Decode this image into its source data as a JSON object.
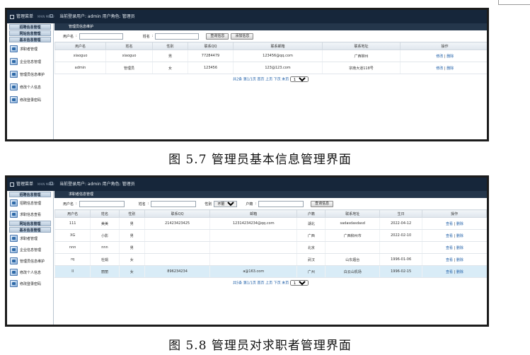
{
  "app": {
    "menu_title": "管理菜单",
    "menu_sub": "MAIN MENU",
    "user_info": "当前登录用户: admin 用户角色: 管理员"
  },
  "figure1": {
    "caption": "图 5.7 管理员基本信息管理界面",
    "sidebar": {
      "heads": [
        "招聘信息管理",
        "网站信息管理",
        "基本信息管理"
      ],
      "items": [
        "求职者管理",
        "企业信息管理",
        "管理员信息维护",
        "修改个人信息",
        "修改登录密码"
      ]
    },
    "panel_title": "管理员信息维护",
    "search": {
      "username_label": "用户名",
      "name_label": "姓名",
      "query_button": "查询信息",
      "add_button": "添加信息"
    },
    "table": {
      "headers": [
        "用户名",
        "姓名",
        "性别",
        "联系QQ",
        "联系邮箱",
        "联系地址",
        "操作"
      ],
      "rows": [
        [
          "xiaoguo",
          "xiaoguo",
          "男",
          "77284479",
          "123456@qq.com",
          "广西柳州"
        ],
        [
          "admin",
          "管理员",
          "女",
          "123456",
          "123@123.com",
          "宗南大道118号"
        ]
      ],
      "op_edit": "修改",
      "op_sep": "|",
      "op_delete": "删除"
    },
    "pager": {
      "text": "共2条 第1/1页 首页 上页 下页 末页",
      "page_value": "1"
    }
  },
  "figure2": {
    "caption": "图 5.8 管理员对求职者管理界面",
    "sidebar": {
      "heads": [
        "招聘信息管理",
        "网站信息管理",
        "基本信息管理"
      ],
      "items_top": [
        "招聘信息管理",
        "求职信息查看"
      ],
      "items": [
        "求职者管理",
        "企业信息管理",
        "管理员信息维护",
        "修改个人信息",
        "修改登录密码"
      ]
    },
    "panel_title": "求职者信息管理",
    "search": {
      "username_label": "用户名",
      "name_label": "姓名",
      "gender_label": "性别",
      "gender_value": "不限",
      "hukou_label": "户籍",
      "query_button": "查询信息"
    },
    "table": {
      "headers": [
        "用户名",
        "姓名",
        "性别",
        "联系QQ",
        "邮箱",
        "户籍",
        "联系地址",
        "生日",
        "操作"
      ],
      "rows": [
        [
          "111",
          "美美",
          "男",
          "21423423425",
          "12314234234@qq.com",
          "湖北",
          "sadasdasdasd",
          "2022-04-12"
        ],
        [
          "XG",
          "小影",
          "男",
          "",
          "",
          "广西",
          "广西柳州市",
          "2022-02-10"
        ],
        [
          "nnn",
          "nnn",
          "男",
          "",
          "",
          "北京",
          "",
          ""
        ],
        [
          "rq",
          "杜娟",
          "女",
          "",
          "",
          "武汉",
          "山东烟台",
          "1996-01-06"
        ],
        [
          "ll",
          "丽丽",
          "女",
          "896234234",
          "a@163.com",
          "广州",
          "白云山机场",
          "1996-02-15"
        ]
      ],
      "op_view": "查看",
      "op_sep": "|",
      "op_delete": "删除"
    },
    "pager": {
      "text": "共5条 第1/1页 首页 上页 下页 末页",
      "page_value": "1"
    }
  }
}
